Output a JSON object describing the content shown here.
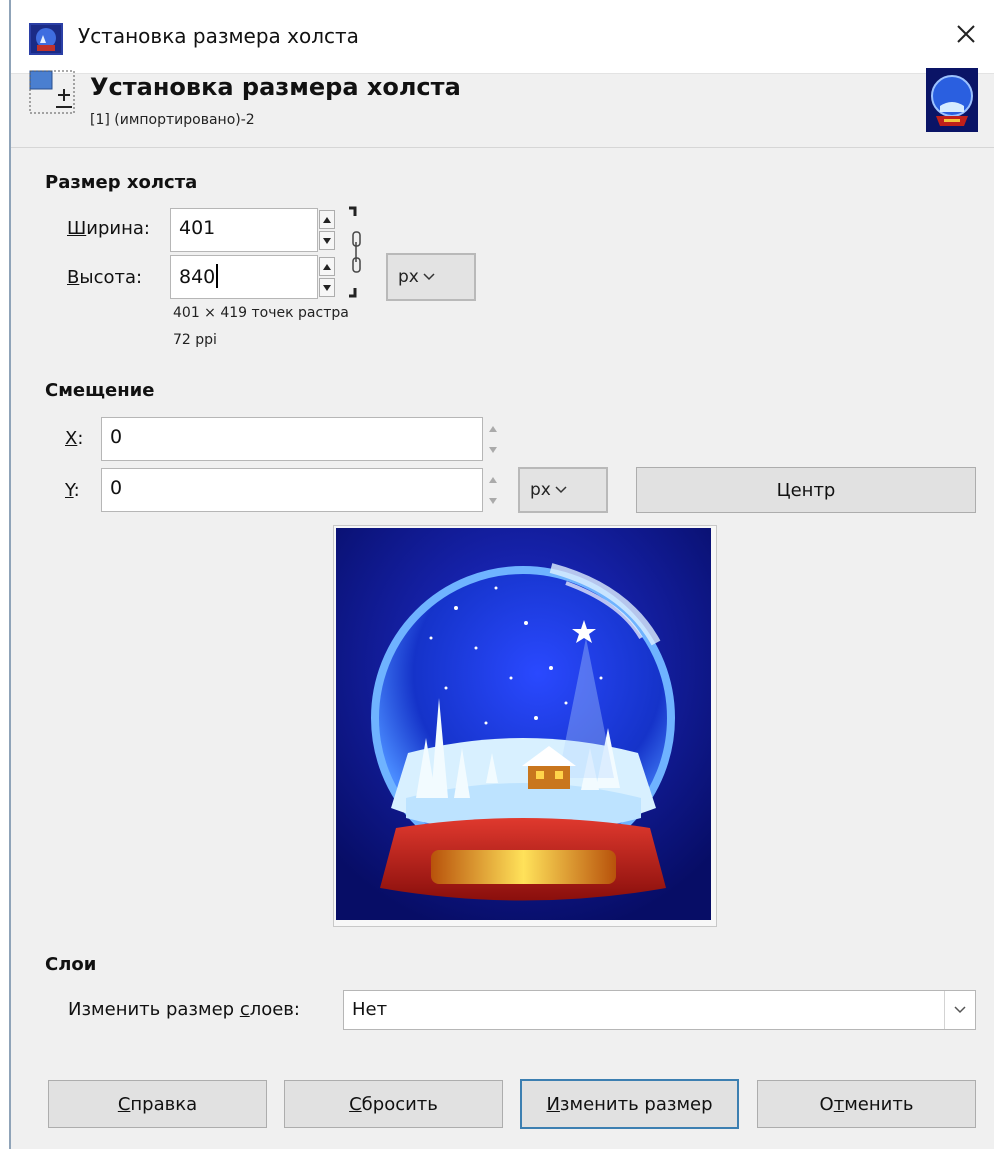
{
  "window": {
    "title": "Установка размера холста"
  },
  "header": {
    "title": "Установка размера холста",
    "subtitle": "[1] (импортировано)-2"
  },
  "canvas_size": {
    "section_title": "Размер холста",
    "width_label_u": "Ш",
    "width_label_rest": "ирина:",
    "width_value": "401",
    "height_label_u": "В",
    "height_label_rest": "ысота:",
    "height_value": "840",
    "unit": "px",
    "info_pixels": "401 × 419 точек растра",
    "info_ppi": "72 ppi"
  },
  "offset": {
    "section_title": "Смещение",
    "x_label_u": "X",
    "x_label_rest": ":",
    "x_value": "0",
    "y_label_u": "Y",
    "y_label_rest": ":",
    "y_value": "0",
    "unit": "px",
    "center_label": "Центр"
  },
  "layers": {
    "section_title": "Слои",
    "resize_label_pre": "Изменить размер ",
    "resize_label_u": "с",
    "resize_label_post": "лоев:",
    "resize_value": "Нет"
  },
  "buttons": {
    "help_u": "С",
    "help_rest": "правка",
    "reset_u": "С",
    "reset_rest": "бросить",
    "resize_u": "И",
    "resize_rest": "зменить размер",
    "cancel_pre": "О",
    "cancel_u": "т",
    "cancel_rest": "менить"
  },
  "icons": {
    "app": "canvas-size-icon",
    "close": "close-icon",
    "chain": "chain-link-icon",
    "thumbnail": "image-thumbnail"
  },
  "colors": {
    "default_button_border": "#3c7fb1",
    "dialog_background": "#f0f0f0"
  }
}
